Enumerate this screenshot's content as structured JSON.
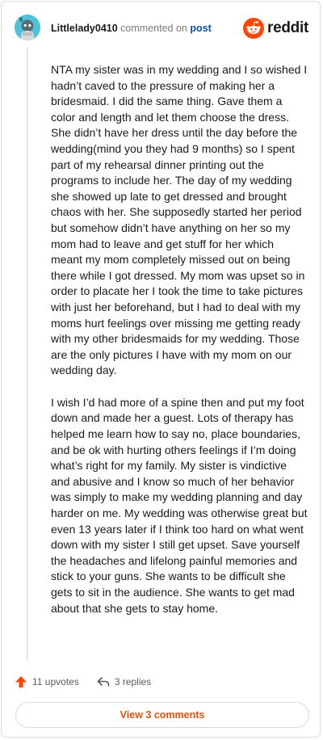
{
  "comment": {
    "username": "Littlelady0410",
    "action_text": "commented on",
    "post_link": "post",
    "paragraphs": [
      "NTA my sister was in my wedding and I so wished I hadn’t caved to the pressure of making her a bridesmaid. I did the same thing. Gave them a color and length and let them choose the dress. She didn’t have her dress until the day before the wedding(mind you they had 9 months) so I spent part of my rehearsal dinner printing out the programs to include her. The day of my wedding she showed up late to get dressed and brought chaos with her. She supposedly started her period but somehow didn’t have anything on her so my mom had to leave and get stuff for her which meant my mom completely missed out on being there while I got dressed. My mom was upset so in order to placate her I took the time to take pictures with just her beforehand, but I had to deal with my moms hurt feelings over missing me getting ready with my other bridesmaids for my wedding. Those are the only pictures I have with my mom on our wedding day.",
      "I wish I’d had more of a spine then and put my foot down and made her a guest. Lots of therapy has helped me learn how to say no, place boundaries, and be ok with hurting others feelings if I’m doing what’s right for my family. My sister is vindictive and abusive and I know so much of her behavior was simply to make my wedding planning and day harder on me. My wedding was otherwise great but even 13 years later if I think too hard on what went down with my sister I still get upset. Save yourself the headaches and lifelong painful memories and stick to your guns. She wants to be difficult she gets to sit in the audience. She wants to get mad about that she gets to stay home."
    ],
    "upvotes_label": "11 upvotes",
    "replies_label": "3 replies",
    "view_comments_label": "View 3 comments"
  },
  "brand": {
    "name": "reddit",
    "icon": "reddit-snoo-icon"
  },
  "icons": {
    "avatar": "avatar-icon",
    "upvote": "upvote-arrow-icon",
    "reply": "reply-arrow-icon"
  },
  "colors": {
    "brand_orange": "#ff4500",
    "upvote_orange": "#ff4500",
    "link_blue": "#0a4fa8",
    "button_text": "#e0520e",
    "avatar_bg": "#4fc3d9"
  }
}
